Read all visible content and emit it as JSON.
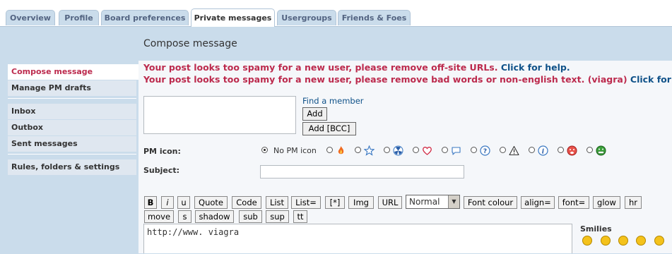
{
  "tabs": [
    "Overview",
    "Profile",
    "Board preferences",
    "Private messages",
    "Usergroups",
    "Friends & Foes"
  ],
  "active_tab": "Private messages",
  "page_title": "Compose message",
  "nav": {
    "items": [
      "Compose message",
      "Manage PM drafts",
      "Inbox",
      "Outbox",
      "Sent messages",
      "Rules, folders & settings"
    ],
    "active": "Compose message"
  },
  "warnings": [
    {
      "text": "Your post looks too spamy for a new user, please remove off-site URLs.",
      "link": "Click for help."
    },
    {
      "text": "Your post looks too spamy for a new user, please remove bad words or non-english text. (viagra)",
      "link": "Click for help."
    }
  ],
  "recipients": {
    "find_member": "Find a member",
    "add_label": "Add",
    "add_bcc_label": "Add [BCC]"
  },
  "pm_icon": {
    "label": "PM icon:",
    "no_icon_label": "No PM icon",
    "selected": "No PM icon",
    "icons": [
      "fire-icon",
      "star-icon",
      "radioactive-icon",
      "heart-icon",
      "speech-bubble-icon",
      "question-icon",
      "warning-icon",
      "info-icon",
      "sad-face-icon",
      "grin-face-icon"
    ]
  },
  "subject": {
    "label": "Subject:",
    "value": ""
  },
  "format_buttons_row1": [
    "B",
    "i",
    "u",
    "Quote",
    "Code",
    "List",
    "List=",
    "[*]",
    "Img",
    "URL"
  ],
  "font_size_select": "Normal",
  "format_buttons_row1b": [
    "Font colour",
    "align=",
    "font=",
    "glow",
    "hr"
  ],
  "format_buttons_row2": [
    "move",
    "s",
    "shadow",
    "sub",
    "sup",
    "tt"
  ],
  "message": {
    "value": "http://www. viagra"
  },
  "smilies": {
    "title": "Smilies"
  },
  "colors": {
    "accent": "#bc2a4d",
    "link": "#105289",
    "panel": "#cadceb"
  }
}
